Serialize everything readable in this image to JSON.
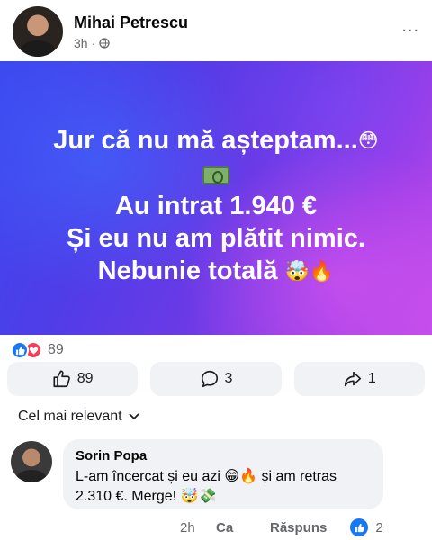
{
  "post": {
    "author": "Mihai Petrescu",
    "time": "3h",
    "privacy_icon": "globe-icon",
    "more_label": "...",
    "image_text": {
      "line1": "Jur că nu mă așteptam...",
      "line1_emoji": "😳",
      "line2_icon": "money-icon",
      "line3": "Au intrat 1.940 €",
      "line4": "Și eu nu am plătit nimic.",
      "line5": "Nebunie totală",
      "line5_emoji": "🤯🔥"
    }
  },
  "reactions": {
    "count": "89",
    "types": [
      "like-icon",
      "love-icon"
    ]
  },
  "actions": {
    "like_count": "89",
    "comment_count": "3",
    "share_count": "1"
  },
  "comments": {
    "sort_label": "Cel mai relevant",
    "items": [
      {
        "author": "Sorin Popa",
        "text_line1": "L-am încercat și eu azi 😁🔥 și am retras",
        "text_line2": "2.310 €. Merge! 🤯💸",
        "time": "2h",
        "like_label": "Ca",
        "reply_label": "Răspuns",
        "like_count": "2"
      }
    ]
  },
  "colors": {
    "accent": "#1877f2",
    "love": "#f33e58",
    "muted": "#65676b",
    "button_bg": "#f0f2f5"
  }
}
